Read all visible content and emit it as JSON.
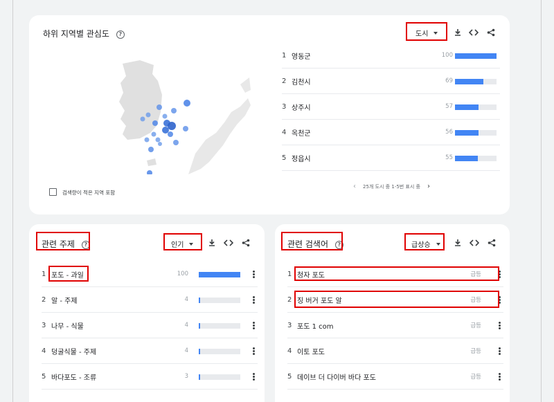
{
  "region": {
    "title": "하위 지역별 관심도",
    "dropdown": "도시",
    "rows": [
      {
        "rank": "1",
        "name": "영동군",
        "value": "100",
        "pct": 100
      },
      {
        "rank": "2",
        "name": "김천시",
        "value": "69",
        "pct": 69
      },
      {
        "rank": "3",
        "name": "상주시",
        "value": "57",
        "pct": 57
      },
      {
        "rank": "4",
        "name": "옥천군",
        "value": "56",
        "pct": 56
      },
      {
        "rank": "5",
        "name": "정읍시",
        "value": "55",
        "pct": 55
      }
    ],
    "pager": "25개 도시 중 1-5번 표시 중",
    "checkbox_label": "검색량이 적은 지역 포함"
  },
  "topics": {
    "title": "관련 주제",
    "dropdown": "인기",
    "rows": [
      {
        "rank": "1",
        "name": "포도 - 과일",
        "value": "100",
        "pct": 100
      },
      {
        "rank": "2",
        "name": "알 - 주제",
        "value": "4",
        "pct": 4
      },
      {
        "rank": "3",
        "name": "나무 - 식물",
        "value": "4",
        "pct": 4
      },
      {
        "rank": "4",
        "name": "덩굴식물 - 주제",
        "value": "4",
        "pct": 4
      },
      {
        "rank": "5",
        "name": "바다포도 - 조류",
        "value": "3",
        "pct": 3
      }
    ]
  },
  "queries": {
    "title": "관련 검색어",
    "dropdown": "급상승",
    "rows": [
      {
        "rank": "1",
        "name": "청자 포도",
        "value": "급등"
      },
      {
        "rank": "2",
        "name": "징 버거 포도 알",
        "value": "급등"
      },
      {
        "rank": "3",
        "name": "포도 1 com",
        "value": "급등"
      },
      {
        "rank": "4",
        "name": "이토 포도",
        "value": "급등"
      },
      {
        "rank": "5",
        "name": "데이브 더 다이버 바다 포도",
        "value": "급등"
      }
    ]
  },
  "icons": {
    "download": "download-icon",
    "embed": "embed-code-icon",
    "share": "share-icon",
    "help": "help-icon"
  },
  "colors": {
    "bar": "#4285f4",
    "highlight": "#e00000",
    "map_dot": "#4285f4"
  }
}
